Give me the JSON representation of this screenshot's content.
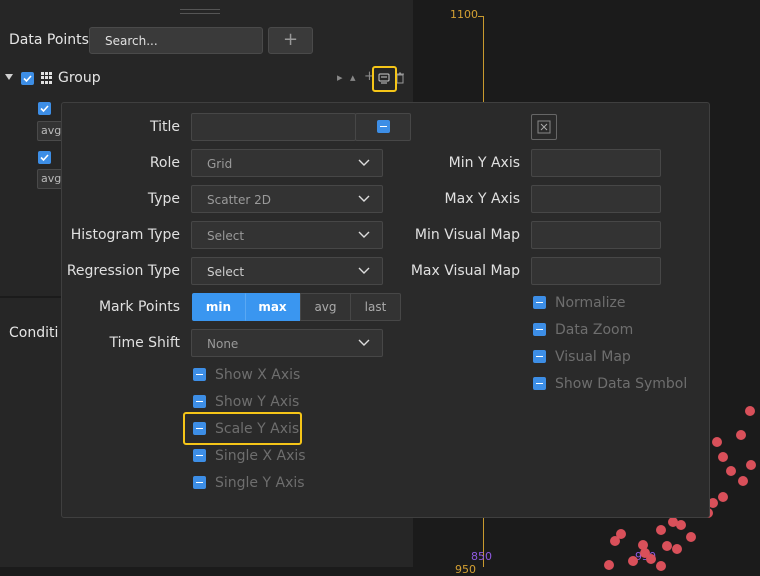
{
  "left_panel": {
    "data_points_label": "Data Points",
    "search_text": "Search...",
    "add_button_label": "+",
    "group_label": "Group",
    "series_items": [
      {
        "agg_label": "avg"
      },
      {
        "agg_label": "avg"
      }
    ],
    "conditions_label": "Conditi"
  },
  "chart": {
    "y_tick_label": "1100",
    "x_tick_label_a": "850",
    "x_tick_label_b": "950",
    "x_tick_label_c": "950",
    "axis_color": "#d4a033",
    "point_color": "#d9505a"
  },
  "dialog": {
    "title_label": "Title",
    "title_value": "",
    "role_label": "Role",
    "role_value": "Grid",
    "type_label": "Type",
    "type_value": "Scatter 2D",
    "histogram_type_label": "Histogram Type",
    "histogram_type_value": "Select",
    "regression_type_label": "Regression Type",
    "regression_type_value": "Select",
    "mark_points_label": "Mark Points",
    "mark_points_options": [
      "min",
      "max",
      "avg",
      "last"
    ],
    "time_shift_label": "Time Shift",
    "time_shift_value": "None",
    "left_checkboxes": [
      "Show X Axis",
      "Show Y Axis",
      "Scale Y Axis",
      "Single X Axis",
      "Single Y Axis"
    ],
    "min_y_axis_label": "Min Y Axis",
    "max_y_axis_label": "Max Y Axis",
    "min_visual_map_label": "Min Visual Map",
    "max_visual_map_label": "Max Visual Map",
    "right_checkboxes": [
      "Normalize",
      "Data Zoom",
      "Visual Map",
      "Show Data Symbol"
    ],
    "accent_color": "#3a96f0",
    "highlight_color": "#f5c518"
  }
}
